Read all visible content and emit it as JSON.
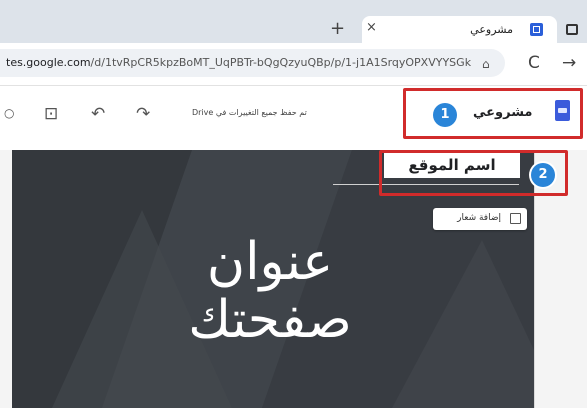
{
  "browser": {
    "tab_title": "مشروعي",
    "tab_close": "×",
    "new_tab": "+",
    "url_host": "tes.google.com",
    "url_path": "/d/1tvRpCR5kpzBoMT_UqPBTr-bQgQzyuQBp/p/1-j1A1SrqyOPXVYYSGk...",
    "bookmark_glyph": "⌂",
    "reload_glyph": "C",
    "forward_glyph": "→"
  },
  "editor": {
    "site_name": "مشروعي",
    "save_status": "تم حفظ جميع التغييرات في Drive",
    "undo_glyph": "↶",
    "redo_glyph": "↷",
    "preview_glyph": "⊡",
    "badge_1": "1",
    "badge_2": "2"
  },
  "page": {
    "site_title": "اسم الموقع",
    "add_logo_label": "إضافة شعار",
    "page_title_line1": "عنوان",
    "page_title_line2": "صفحتك"
  },
  "colors": {
    "callout": "#d12b2b",
    "badge": "#2a85d8",
    "canvas": "#3b3f45"
  }
}
